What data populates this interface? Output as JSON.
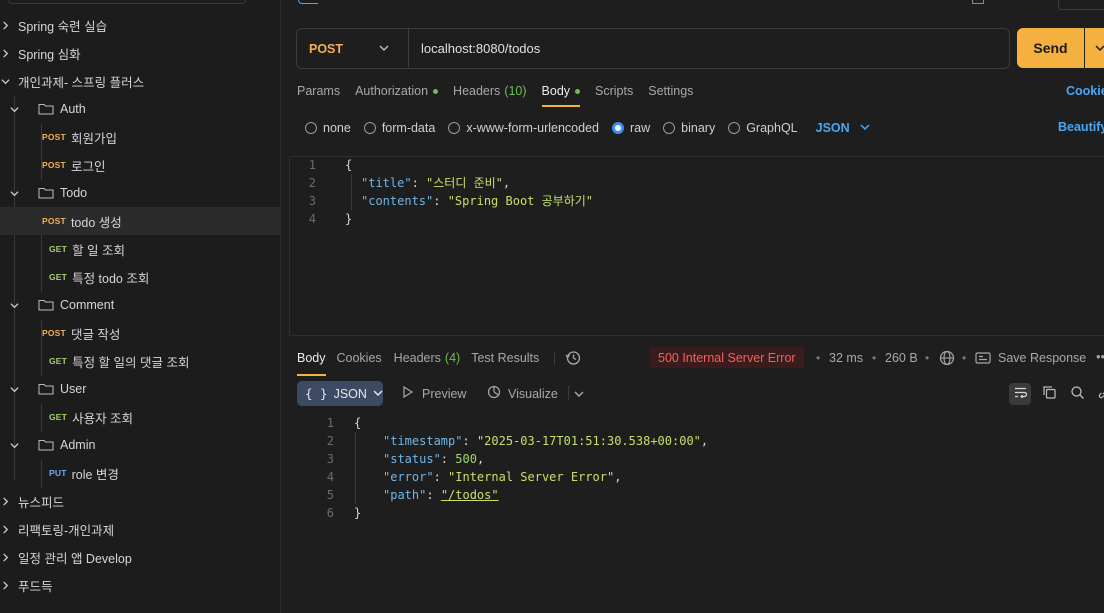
{
  "sidebar": {
    "items": [
      {
        "label": "Spring 숙련 실습",
        "type": "collection"
      },
      {
        "label": "Spring 심화",
        "type": "collection"
      },
      {
        "label": "개인과제- 스프링 플러스",
        "type": "collection-open"
      },
      {
        "label": "Auth",
        "type": "folder"
      },
      {
        "method": "POST",
        "label": "회원가입"
      },
      {
        "method": "POST",
        "label": "로그인"
      },
      {
        "label": "Todo",
        "type": "folder"
      },
      {
        "method": "POST",
        "label": "todo 생성"
      },
      {
        "method": "GET",
        "label": "할 일 조회"
      },
      {
        "method": "GET",
        "label": "특정 todo 조회"
      },
      {
        "label": "Comment",
        "type": "folder"
      },
      {
        "method": "POST",
        "label": "댓글 작성"
      },
      {
        "method": "GET",
        "label": "특정 할 일의 댓글 조회"
      },
      {
        "label": "User",
        "type": "folder"
      },
      {
        "method": "GET",
        "label": "사용자 조회"
      },
      {
        "label": "Admin",
        "type": "folder"
      },
      {
        "method": "PUT",
        "label": "role 변경"
      },
      {
        "label": "뉴스피드",
        "type": "collection"
      },
      {
        "label": "리팩토링-개인과제",
        "type": "collection"
      },
      {
        "label": "일정 관리 앱 Develop",
        "type": "collection"
      },
      {
        "label": "푸드득",
        "type": "collection"
      }
    ]
  },
  "request": {
    "method": "POST",
    "url": "localhost:8080/todos",
    "send_label": "Send",
    "tabs": {
      "params": "Params",
      "authorization": "Authorization",
      "headers": "Headers",
      "headers_count": "(10)",
      "body": "Body",
      "scripts": "Scripts",
      "settings": "Settings"
    },
    "cookies_label": "Cookies",
    "body_types": [
      "none",
      "form-data",
      "x-www-form-urlencoded",
      "raw",
      "binary",
      "GraphQL"
    ],
    "selected_body_type": "raw",
    "format": "JSON",
    "beautify_label": "Beautify",
    "body_lines": [
      {
        "n": "1",
        "text": "{"
      },
      {
        "n": "2",
        "key": "\"title\"",
        "value": "\"스터디 준비\"",
        "trail": ","
      },
      {
        "n": "3",
        "key": "\"contents\"",
        "value": "\"Spring Boot 공부하기\"",
        "trail": ""
      },
      {
        "n": "4",
        "text": "}"
      }
    ]
  },
  "response": {
    "tabs": {
      "body": "Body",
      "cookies": "Cookies",
      "headers": "Headers",
      "headers_count": "(4)",
      "test_results": "Test Results"
    },
    "status": "500 Internal Server Error",
    "time": "32 ms",
    "size": "260 B",
    "save_label": "Save Response",
    "view_format": "JSON",
    "preview_label": "Preview",
    "visualize_label": "Visualize",
    "body_lines": [
      {
        "n": "1",
        "text": "{"
      },
      {
        "n": "2",
        "key": "\"timestamp\"",
        "value": "\"2025-03-17T01:51:30.538+00:00\"",
        "trail": ","
      },
      {
        "n": "3",
        "key": "\"status\"",
        "num": "500",
        "trail": ","
      },
      {
        "n": "4",
        "key": "\"error\"",
        "value": "\"Internal Server Error\"",
        "trail": ","
      },
      {
        "n": "5",
        "key": "\"path\"",
        "link": "\"/todos\"",
        "trail": ""
      },
      {
        "n": "6",
        "text": "}"
      }
    ]
  },
  "colors": {
    "accent": "#f5b13f",
    "post": "#f5b04e",
    "get": "#a3d36f",
    "put": "#6fa8ff",
    "error": "#f1615b",
    "link": "#49a7f2"
  }
}
